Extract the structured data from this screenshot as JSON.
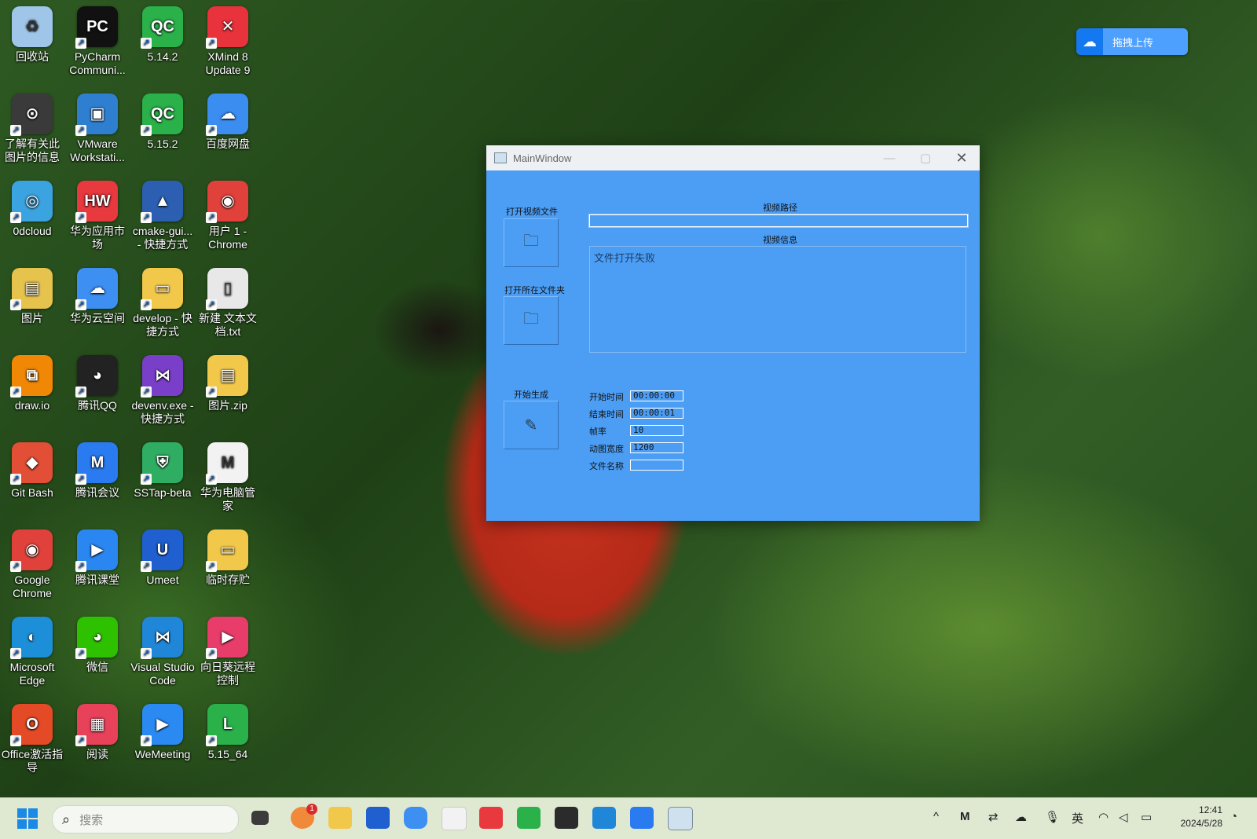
{
  "desktop": {
    "icons": [
      {
        "label": "回收站",
        "glyph": "♻",
        "color": "#9fc5e8"
      },
      {
        "label": "PyCharm Communi...",
        "glyph": "PC",
        "color": "#111111"
      },
      {
        "label": "5.14.2",
        "glyph": "QC",
        "color": "#2ab14a"
      },
      {
        "label": "XMind 8 Update 9",
        "glyph": "✕",
        "color": "#e8323c"
      },
      {
        "label": "了解有关此图片的信息",
        "glyph": "⊙",
        "color": "#3a3a3a"
      },
      {
        "label": "VMware Workstati...",
        "glyph": "▣",
        "color": "#2f7fd1"
      },
      {
        "label": "5.15.2",
        "glyph": "QC",
        "color": "#2ab14a"
      },
      {
        "label": "百度网盘",
        "glyph": "☁",
        "color": "#3b8df0"
      },
      {
        "label": "0dcloud",
        "glyph": "◎",
        "color": "#3aa3e0"
      },
      {
        "label": "华为应用市场",
        "glyph": "HW",
        "color": "#e8393f"
      },
      {
        "label": "cmake-gui... - 快捷方式",
        "glyph": "▲",
        "color": "#2c5fb2"
      },
      {
        "label": "用户 1 - Chrome",
        "glyph": "◉",
        "color": "#e0413b"
      },
      {
        "label": "图片",
        "glyph": "▤",
        "color": "#e6c34d"
      },
      {
        "label": "华为云空间",
        "glyph": "☁",
        "color": "#3d8ff2"
      },
      {
        "label": "develop - 快捷方式",
        "glyph": "▭",
        "color": "#f2c84b"
      },
      {
        "label": "新建 文本文档.txt",
        "glyph": "▯",
        "color": "#e8e8e8"
      },
      {
        "label": "draw.io",
        "glyph": "⧉",
        "color": "#f08705"
      },
      {
        "label": "腾讯QQ",
        "glyph": "◕",
        "color": "#222222"
      },
      {
        "label": "devenv.exe - 快捷方式",
        "glyph": "⋈",
        "color": "#7a3fc9"
      },
      {
        "label": "图片.zip",
        "glyph": "▤",
        "color": "#f2c84b"
      },
      {
        "label": "Git Bash",
        "glyph": "◆",
        "color": "#e24e36"
      },
      {
        "label": "腾讯会议",
        "glyph": "M",
        "color": "#2a7af0"
      },
      {
        "label": "SSTap-beta",
        "glyph": "⛨",
        "color": "#2fae63"
      },
      {
        "label": "华为电脑管家",
        "glyph": "M",
        "color": "#f2f2f2"
      },
      {
        "label": "Google Chrome",
        "glyph": "◉",
        "color": "#e0413b"
      },
      {
        "label": "腾讯课堂",
        "glyph": "▶",
        "color": "#2a86f0"
      },
      {
        "label": "Umeet",
        "glyph": "U",
        "color": "#1f5fd0"
      },
      {
        "label": "临时存贮",
        "glyph": "▭",
        "color": "#f2c84b"
      },
      {
        "label": "Microsoft Edge",
        "glyph": "◐",
        "color": "#1d8fd8"
      },
      {
        "label": "微信",
        "glyph": "◕",
        "color": "#2dc100"
      },
      {
        "label": "Visual Studio Code",
        "glyph": "⋈",
        "color": "#1f86d8"
      },
      {
        "label": "向日葵远程控制",
        "glyph": "▶",
        "color": "#e83c6a"
      },
      {
        "label": "Office激活指导",
        "glyph": "O",
        "color": "#e34a25"
      },
      {
        "label": "阅读",
        "glyph": "▦",
        "color": "#e8415a"
      },
      {
        "label": "WeMeeting",
        "glyph": "▶",
        "color": "#2a8af2"
      },
      {
        "label": "5.15_64",
        "glyph": "L",
        "color": "#2ab14a"
      }
    ]
  },
  "upload_widget": {
    "label": "拖拽上传"
  },
  "window": {
    "title": "MainWindow",
    "open_video_label": "打开视频文件",
    "open_folder_label": "打开所在文件夹",
    "generate_label": "开始生成",
    "video_path_label": "视频路径",
    "video_path_value": "",
    "video_info_label": "视频信息",
    "video_info_value": "文件打开失败",
    "params": {
      "start_time_label": "开始时间",
      "start_time": "00:00:00",
      "end_time_label": "结束时间",
      "end_time": "00:00:01",
      "fps_label": "帧率",
      "fps": "10",
      "gif_width_label": "动图宽度",
      "gif_width": "1200",
      "file_name_label": "文件名称",
      "file_name": ""
    }
  },
  "taskbar": {
    "search_placeholder": "搜索",
    "badge_count": "1",
    "ime": "英",
    "time": "12:41",
    "date": "2024/5/28"
  }
}
